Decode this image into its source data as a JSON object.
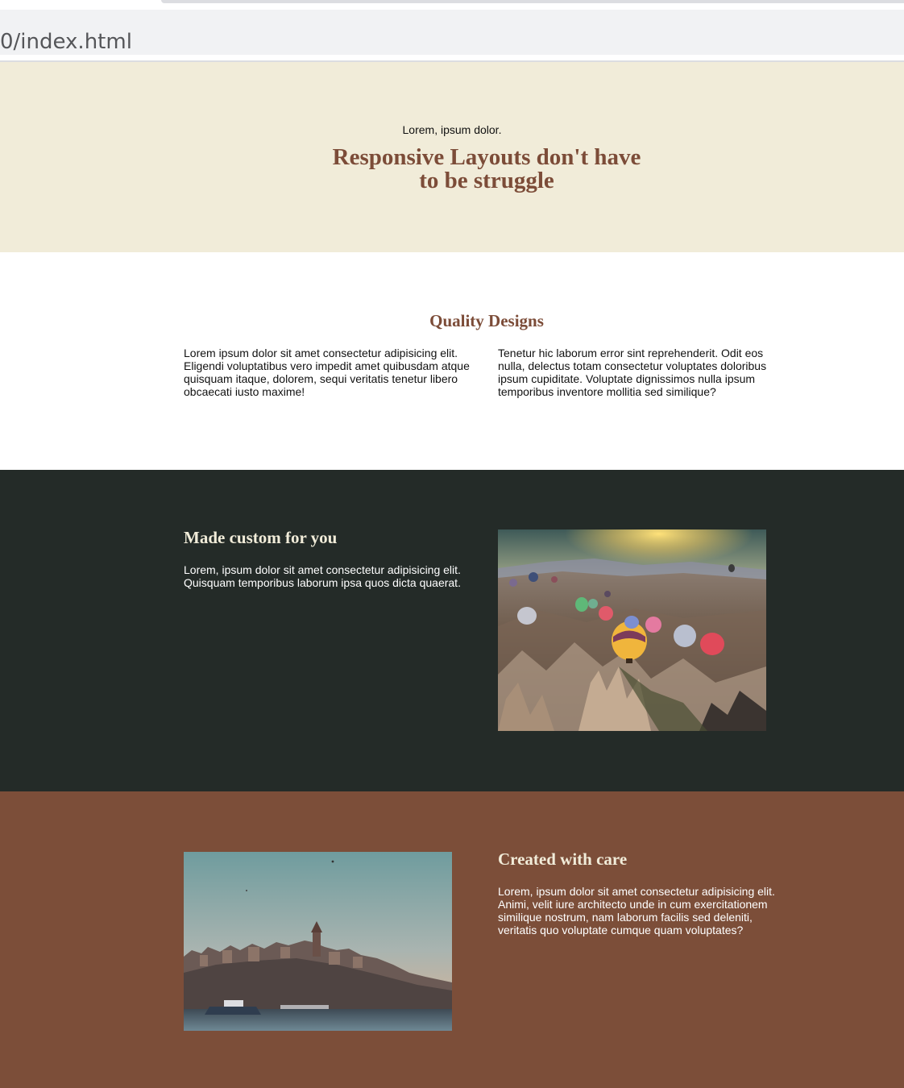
{
  "browser": {
    "url": "0/index.html"
  },
  "hero": {
    "pretitle": "Lorem, ipsum dolor.",
    "title": "Responsive Layouts don't have to be struggle"
  },
  "quality": {
    "title": "Quality Designs",
    "left_text": "Lorem ipsum dolor sit amet consectetur adipisicing elit. Eligendi voluptatibus vero impedit amet quibusdam atque quisquam itaque, dolorem, sequi veritatis tenetur libero obcaecati iusto maxime!",
    "right_text": "Tenetur hic laborum error sint reprehenderit. Odit eos nulla, delectus totam consectetur voluptates doloribus ipsum cupiditate. Voluptate dignissimos nulla ipsum temporibus inventore mollitia sed similique?"
  },
  "custom": {
    "title": "Made custom for you",
    "text": "Lorem, ipsum dolor sit amet consectetur adipisicing elit. Quisquam temporibus laborum ipsa quos dicta quaerat.",
    "image_icon": "hot-air-balloons-image"
  },
  "care": {
    "title": "Created with care",
    "text": "Lorem, ipsum dolor sit amet consectetur adipisicing elit. Animi, velit iure architecto unde in cum exercitationem similique nostrum, nam laborum facilis sed deleniti, veritatis quo voluptate cumque quam voluptates?",
    "image_icon": "city-skyline-image"
  },
  "colors": {
    "hero_bg": "#f1ecd9",
    "accent_brown": "#7c4c38",
    "dark_bg": "#242b28",
    "brown_bg": "#7c4e39",
    "cream_heading": "#f1ecd9"
  }
}
